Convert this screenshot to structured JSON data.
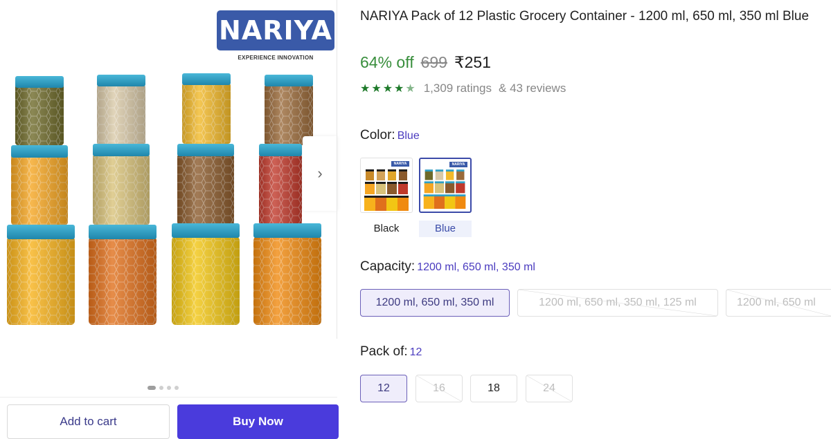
{
  "brand": {
    "name": "NARIYA",
    "tagline": "EXPERIENCE INNOVATION"
  },
  "gallery": {
    "dots": 4,
    "active_dot": 0,
    "next_icon": "chevron-right-icon"
  },
  "actions": {
    "add_to_cart": "Add to cart",
    "buy_now": "Buy Now"
  },
  "product": {
    "title": "NARIYA Pack of 12 Plastic Grocery Container  - 1200 ml, 650 ml, 350 ml Blue",
    "discount": "64% off",
    "mrp": "699",
    "price": "₹251",
    "rating_stars": 4.5,
    "ratings": "1,309 ratings",
    "reviews": "& 43 reviews"
  },
  "color": {
    "label": "Color:",
    "value": "Blue",
    "options": [
      {
        "label": "Black",
        "selected": false
      },
      {
        "label": "Blue",
        "selected": true
      }
    ]
  },
  "capacity": {
    "label": "Capacity:",
    "value": "1200 ml, 650 ml, 350 ml",
    "options": [
      {
        "label": "1200 ml, 650 ml, 350 ml",
        "state": "selected"
      },
      {
        "label": "1200 ml, 650 ml, 350 ml, 125 ml",
        "state": "disabled"
      },
      {
        "label": "1200 ml, 650 ml",
        "state": "disabled"
      }
    ]
  },
  "pack": {
    "label": "Pack of:",
    "value": "12",
    "options": [
      {
        "label": "12",
        "state": "selected"
      },
      {
        "label": "16",
        "state": "disabled"
      },
      {
        "label": "18",
        "state": "available"
      },
      {
        "label": "24",
        "state": "disabled"
      }
    ]
  },
  "colors": {
    "accent": "#4a3bdc",
    "discount_green": "#388e3c",
    "star_green": "#1e7a2a",
    "lid_blue": "#2f9fc4",
    "lid_black": "#1c1c1c",
    "logo_blue": "#3a5aa8"
  }
}
